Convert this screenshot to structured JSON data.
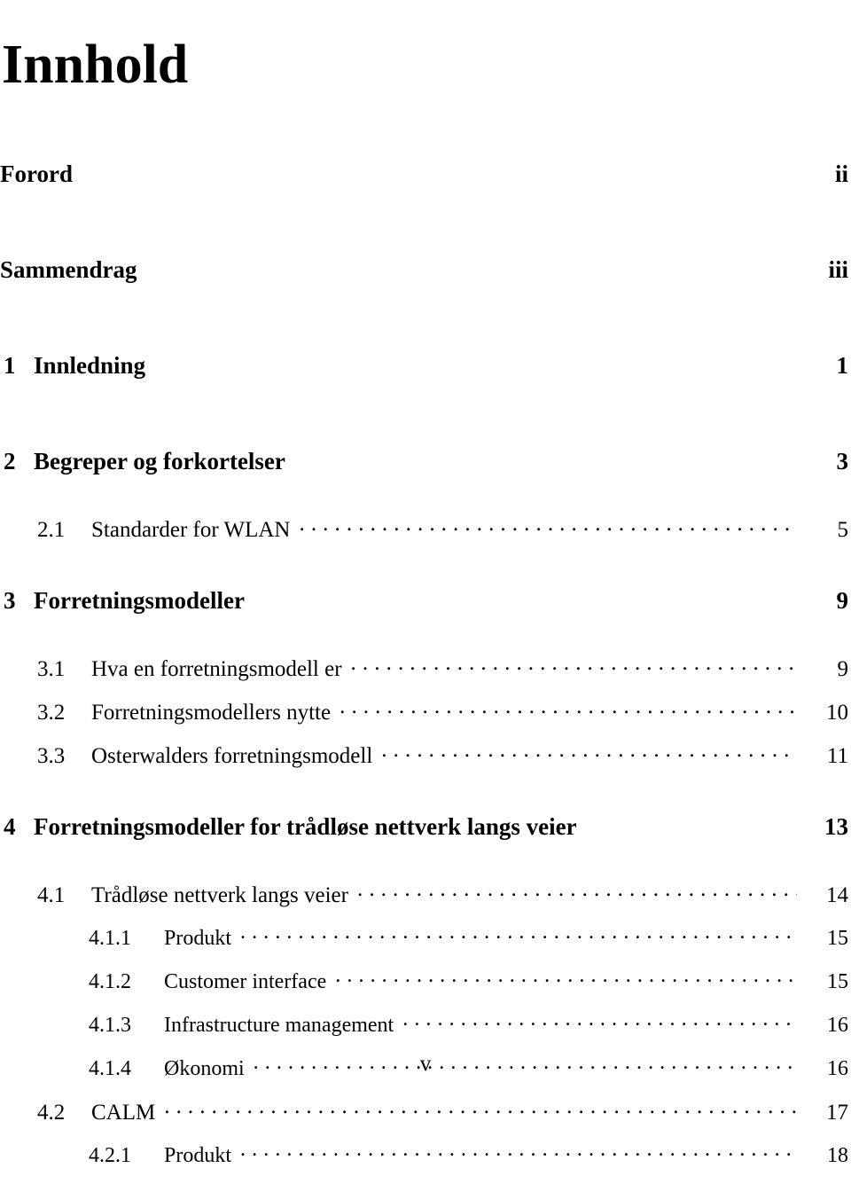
{
  "document": {
    "title": "Innhold",
    "folio": "v"
  },
  "toc": {
    "entries": [
      {
        "level": "front",
        "number": "",
        "label": "Forord",
        "page": "ii",
        "leader": false,
        "gap": false
      },
      {
        "level": "front",
        "number": "",
        "label": "Sammendrag",
        "page": "iii",
        "leader": false,
        "gap": true
      },
      {
        "level": "chap",
        "number": "1",
        "label": "Innledning",
        "page": "1",
        "leader": false,
        "gap": true
      },
      {
        "level": "chap",
        "number": "2",
        "label": "Begreper og forkortelser",
        "page": "3",
        "leader": false,
        "gap": true
      },
      {
        "level": "sec",
        "number": "2.1",
        "label": "Standarder for WLAN",
        "page": "5",
        "leader": true,
        "gap": false
      },
      {
        "level": "chap",
        "number": "3",
        "label": "Forretningsmodeller",
        "page": "9",
        "leader": false,
        "gap": true
      },
      {
        "level": "sec",
        "number": "3.1",
        "label": "Hva en forretningsmodell er",
        "page": "9",
        "leader": true,
        "gap": false
      },
      {
        "level": "sec",
        "number": "3.2",
        "label": "Forretningsmodellers nytte",
        "page": "10",
        "leader": true,
        "gap": false
      },
      {
        "level": "sec",
        "number": "3.3",
        "label": "Osterwalders forretningsmodell",
        "page": "11",
        "leader": true,
        "gap": false
      },
      {
        "level": "chap",
        "number": "4",
        "label": "Forretningsmodeller for trådløse nettverk langs veier",
        "page": "13",
        "leader": false,
        "gap": true
      },
      {
        "level": "sec",
        "number": "4.1",
        "label": "Trådløse nettverk langs veier",
        "page": "14",
        "leader": true,
        "gap": false
      },
      {
        "level": "sub",
        "number": "4.1.1",
        "label": "Produkt",
        "page": "15",
        "leader": true,
        "gap": false
      },
      {
        "level": "sub",
        "number": "4.1.2",
        "label": "Customer interface",
        "page": "15",
        "leader": true,
        "gap": false
      },
      {
        "level": "sub",
        "number": "4.1.3",
        "label": "Infrastructure management",
        "page": "16",
        "leader": true,
        "gap": false
      },
      {
        "level": "sub",
        "number": "4.1.4",
        "label": "Økonomi",
        "page": "16",
        "leader": true,
        "gap": false
      },
      {
        "level": "sec",
        "number": "4.2",
        "label": "CALM",
        "page": "17",
        "leader": true,
        "gap": false
      },
      {
        "level": "sub",
        "number": "4.2.1",
        "label": "Produkt",
        "page": "18",
        "leader": true,
        "gap": false
      }
    ],
    "leader_dot": "."
  }
}
